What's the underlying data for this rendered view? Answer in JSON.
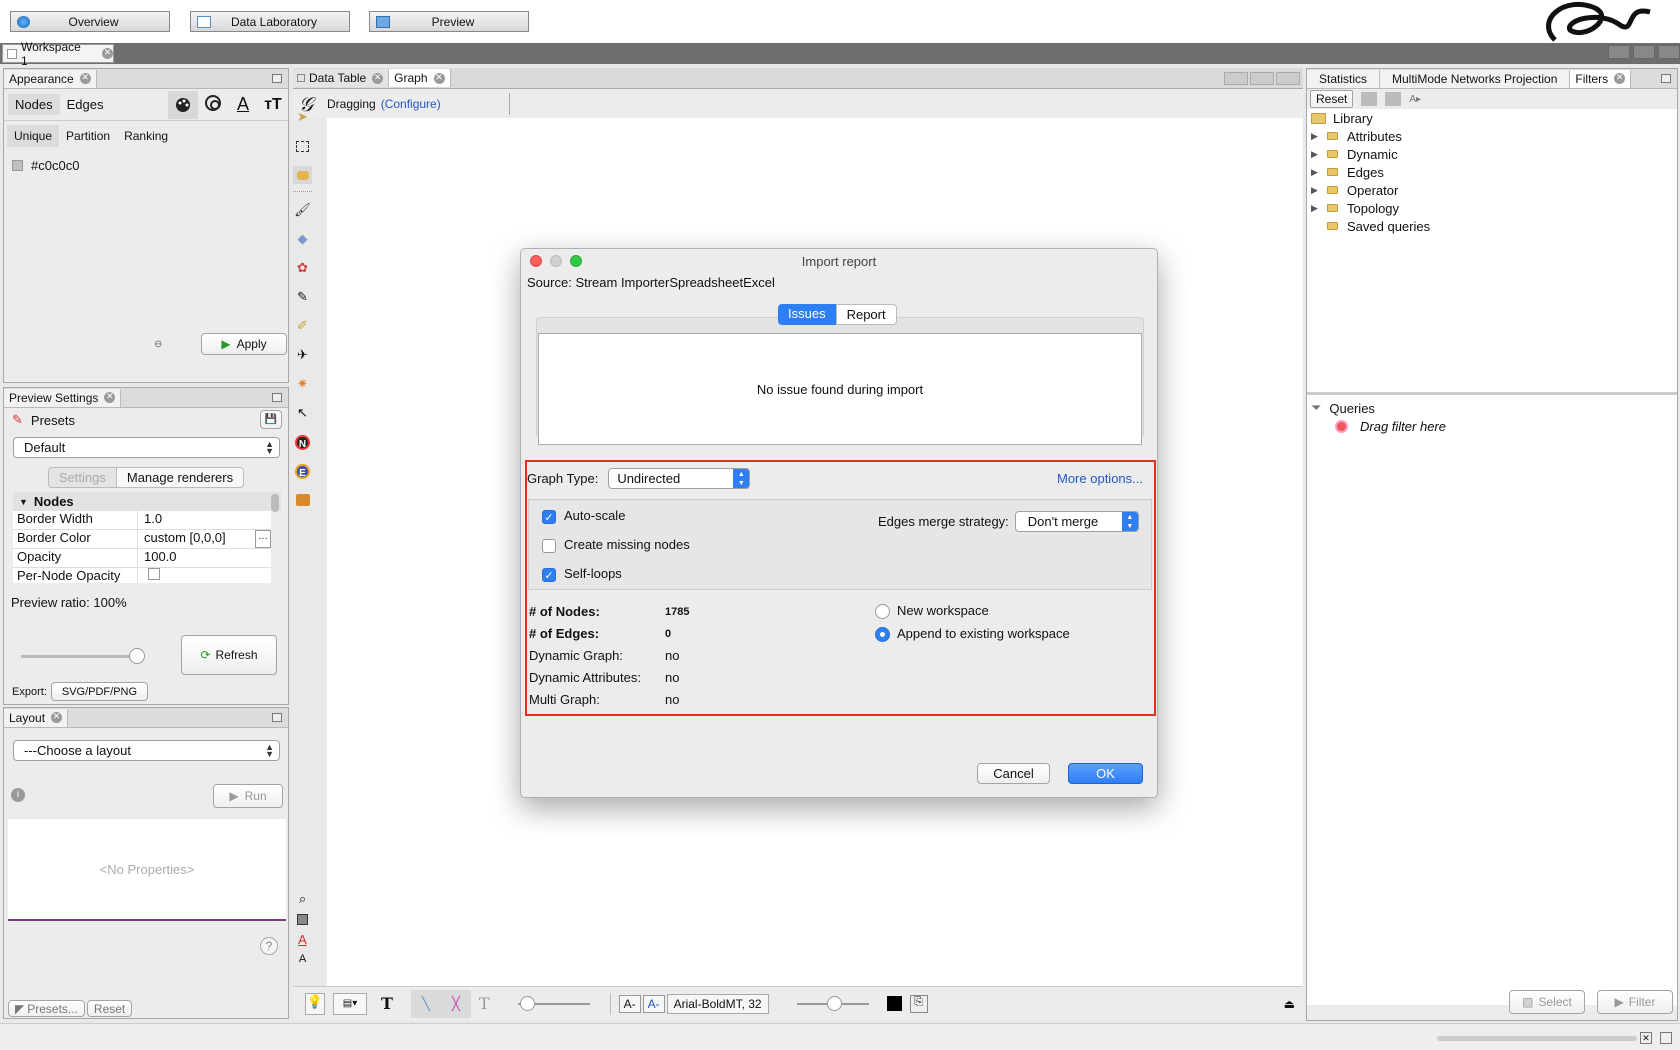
{
  "modes": {
    "overview": "Overview",
    "data_lab": "Data Laboratory",
    "preview": "Preview"
  },
  "workspace": {
    "tab": "Workspace 1"
  },
  "appearance": {
    "title": "Appearance",
    "tabs": [
      "Nodes",
      "Edges"
    ],
    "subtabs": [
      "Unique",
      "Partition",
      "Ranking"
    ],
    "color_value": "#c0c0c0",
    "apply": "Apply"
  },
  "preview_settings": {
    "title": "Preview Settings",
    "presets_label": "Presets",
    "preset_value": "Default",
    "tab_settings": "Settings",
    "tab_manage": "Manage renderers",
    "section": "Nodes",
    "props": [
      {
        "k": "Border Width",
        "v": "1.0"
      },
      {
        "k": "Border Color",
        "v": "custom [0,0,0]"
      },
      {
        "k": "Opacity",
        "v": "100.0"
      },
      {
        "k": "Per-Node Opacity",
        "v": ""
      }
    ],
    "ratio_label": "Preview ratio:",
    "ratio_value": "100%",
    "ratio": 1.0,
    "refresh": "Refresh",
    "export_label": "Export:",
    "export_button": "SVG/PDF/PNG"
  },
  "layout": {
    "title": "Layout",
    "choose": "---Choose a layout",
    "run": "Run",
    "no_props": "<No Properties>",
    "presets": "Presets...",
    "reset": "Reset"
  },
  "center_tabs": {
    "data_table": "Data Table",
    "graph": "Graph"
  },
  "graph_tool": {
    "mode": "Dragging",
    "configure": "(Configure)"
  },
  "bottom_toolbar": {
    "font": "Arial-BoldMT, 32"
  },
  "dialog": {
    "title": "Import report",
    "source_label": "Source:",
    "source_value": "Stream ImporterSpreadsheetExcel",
    "tab_issues": "Issues",
    "tab_report": "Report",
    "no_issue": "No issue found during import",
    "graph_type_label": "Graph Type:",
    "graph_type_value": "Undirected",
    "more_options": "More options...",
    "auto_scale": "Auto-scale",
    "create_missing": "Create missing nodes",
    "self_loops": "Self-loops",
    "merge_label": "Edges merge strategy:",
    "merge_value": "Don't merge",
    "stats": [
      {
        "k": "# of Nodes:",
        "v": "1785"
      },
      {
        "k": "# of Edges:",
        "v": "0"
      },
      {
        "k": "Dynamic Graph:",
        "v": "no"
      },
      {
        "k": "Dynamic Attributes:",
        "v": "no"
      },
      {
        "k": "Multi Graph:",
        "v": "no"
      }
    ],
    "new_workspace": "New workspace",
    "append_workspace": "Append to existing workspace",
    "cancel": "Cancel",
    "ok": "OK",
    "accent": "#2d7ff3",
    "highlight": "#e0301e"
  },
  "right_panel": {
    "tabs": [
      "Statistics",
      "MultiMode Networks Projection",
      "Filters"
    ],
    "reset": "Reset",
    "library": "Library",
    "tree": [
      "Attributes",
      "Dynamic",
      "Edges",
      "Operator",
      "Topology",
      "Saved queries"
    ],
    "queries": "Queries",
    "drag_filter": "Drag filter here",
    "select": "Select",
    "filter": "Filter"
  }
}
